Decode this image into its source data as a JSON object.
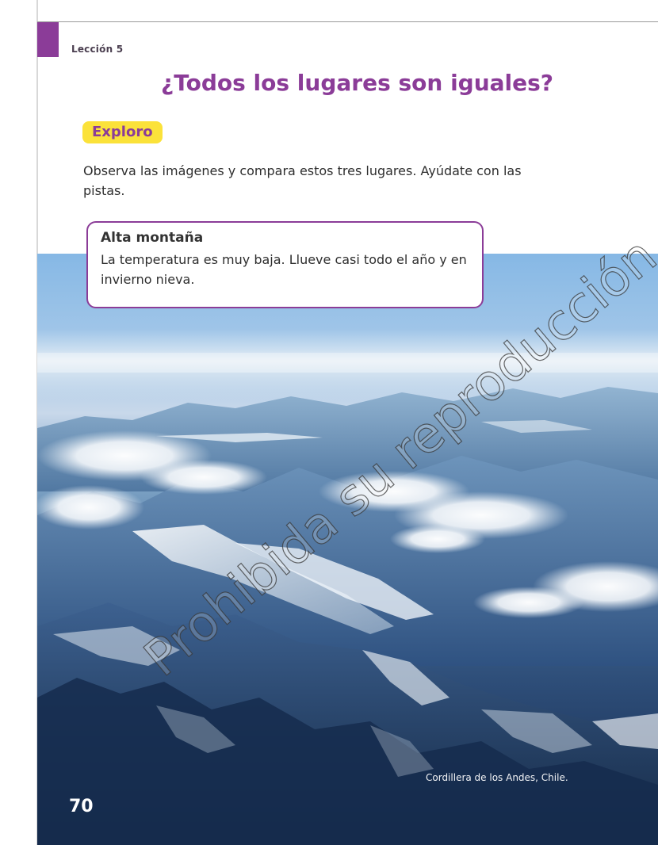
{
  "lesson": {
    "label": "Lección 5",
    "title": "¿Todos los lugares son iguales?"
  },
  "section": {
    "label": "Exploro",
    "instructions": "Observa las imágenes y compara estos tres lugares. Ayúdate con las pistas."
  },
  "clue": {
    "title": "Alta montaña",
    "text": "La temperatura es muy baja. Llueve casi todo el año y en invierno nieva."
  },
  "photo": {
    "caption": "Cordillera de los Andes, Chile."
  },
  "page": {
    "number": "70",
    "watermark": "Prohibida su reproducción"
  },
  "colors": {
    "accent_purple": "#8b3c98",
    "highlight_yellow": "#fbe23a",
    "sky_blue": "#86b8e5",
    "mountain_blue": "#2e4e79"
  }
}
